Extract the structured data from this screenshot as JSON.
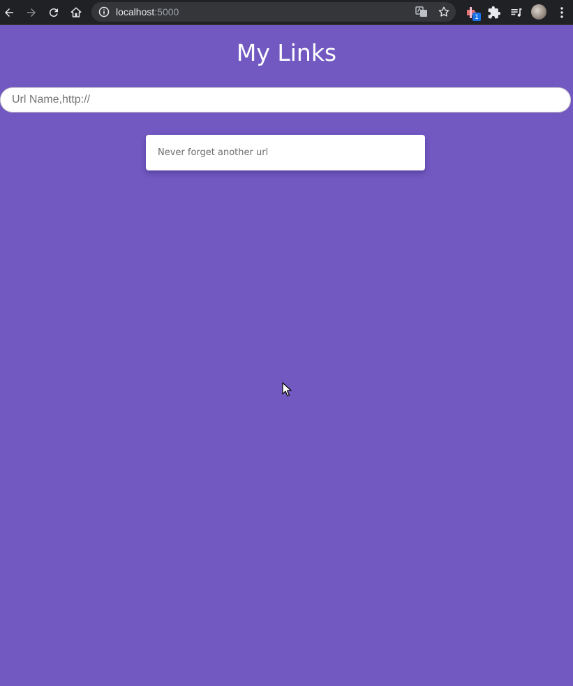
{
  "browser": {
    "url_host": "localhost",
    "url_port": ":5000",
    "extension_badge": "1"
  },
  "page": {
    "title": "My Links",
    "url_input_placeholder": "Url Name,http://",
    "card_text": "Never forget another url"
  },
  "colors": {
    "background": "#7159c1",
    "card": "#ffffff",
    "chrome": "#202124"
  }
}
